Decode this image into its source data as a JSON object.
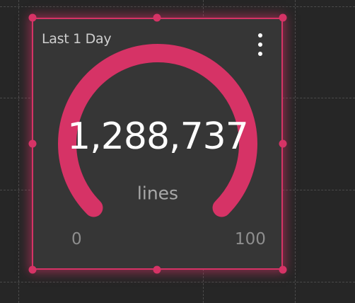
{
  "widget": {
    "title": "Last 1 Day",
    "menu_icon": "kebab-menu-icon",
    "value": "1,288,737",
    "unit": "lines",
    "min_label": "0",
    "max_label": "100"
  },
  "gauge": {
    "min": 0,
    "max": 100,
    "fill_fraction": 1.0,
    "color": "#d63366"
  },
  "colors": {
    "background": "#262626",
    "panel": "#363636",
    "accent": "#d63366"
  }
}
